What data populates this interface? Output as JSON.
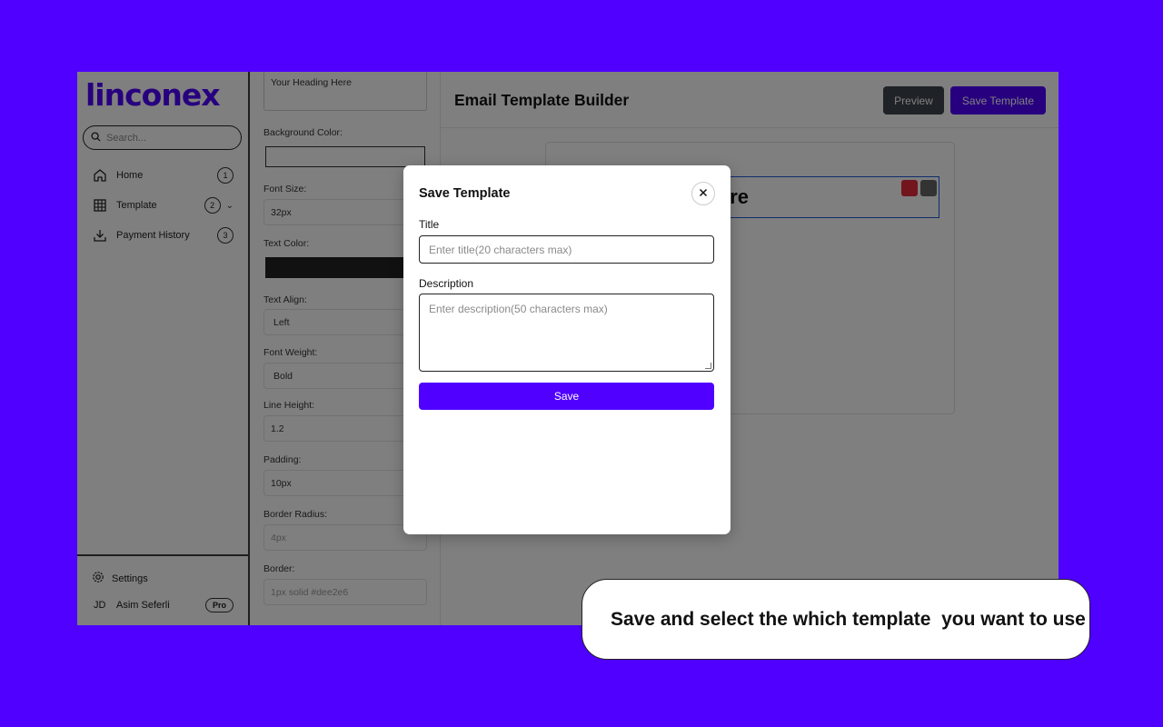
{
  "app": {
    "logo": "linconex",
    "search_placeholder": "Search...",
    "nav": [
      {
        "label": "Home",
        "badge": "1",
        "icon": "home-icon"
      },
      {
        "label": "Template",
        "badge": "2",
        "icon": "grid-icon"
      },
      {
        "label": "Payment History",
        "badge": "3",
        "icon": "download-icon"
      }
    ],
    "footer": {
      "settings_label": "Settings",
      "user_initials": "JD",
      "user_name": "Asim Seferli",
      "plan_badge": "Pro"
    }
  },
  "properties": {
    "content_value": "Your Heading Here",
    "background_color_label": "Background Color:",
    "font_size_label": "Font Size:",
    "font_size_value": "32px",
    "text_color_label": "Text Color:",
    "text_align_label": "Text Align:",
    "text_align_value": "Left",
    "font_weight_label": "Font Weight:",
    "font_weight_value": "Bold",
    "line_height_label": "Line Height:",
    "line_height_value": "1.2",
    "padding_label": "Padding:",
    "padding_value": "10px",
    "border_radius_label": "Border Radius:",
    "border_radius_placeholder": "4px",
    "border_label": "Border:",
    "border_placeholder": "1px solid #dee2e6"
  },
  "main": {
    "title": "Email Template Builder",
    "preview_label": "Preview",
    "save_template_label": "Save Template",
    "canvas_heading_visible": "ere"
  },
  "modal": {
    "title": "Save Template",
    "close_icon": "close-icon",
    "title_field_label": "Title",
    "title_placeholder": "Enter title(20 characters max)",
    "description_field_label": "Description",
    "description_placeholder": "Enter description(50 characters max)",
    "save_label": "Save"
  },
  "callout": {
    "text": "Save and select the which template  you want to use"
  },
  "colors": {
    "accent": "#4f00ff",
    "preview_button": "#3e454d",
    "delete_tool": "#e52b3a",
    "text_color_swatch": "#222222"
  }
}
